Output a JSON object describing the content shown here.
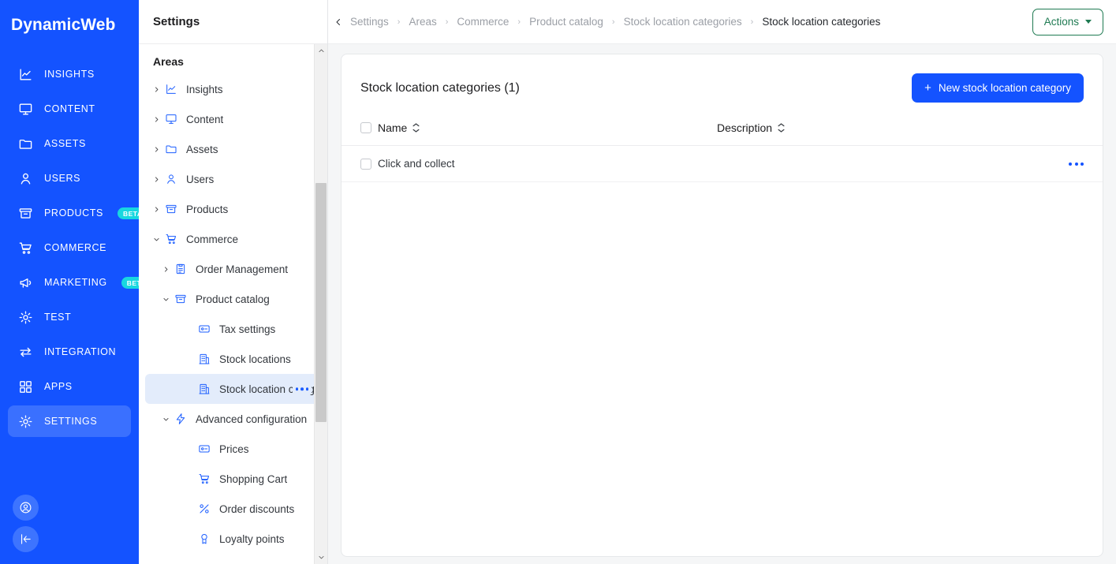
{
  "brand": {
    "name": "DynamicWeb"
  },
  "rail": {
    "items": [
      {
        "label": "INSIGHTS",
        "icon": "insights-icon",
        "badge": null,
        "active": false
      },
      {
        "label": "CONTENT",
        "icon": "monitor-icon",
        "badge": null,
        "active": false
      },
      {
        "label": "ASSETS",
        "icon": "folder-icon",
        "badge": null,
        "active": false
      },
      {
        "label": "USERS",
        "icon": "user-icon",
        "badge": null,
        "active": false
      },
      {
        "label": "PRODUCTS",
        "icon": "box-icon",
        "badge": "BETA",
        "active": false
      },
      {
        "label": "COMMERCE",
        "icon": "cart-icon",
        "badge": null,
        "active": false
      },
      {
        "label": "MARKETING",
        "icon": "megaphone-icon",
        "badge": "BETA",
        "active": false
      },
      {
        "label": "TEST",
        "icon": "gear-icon",
        "badge": null,
        "active": false
      },
      {
        "label": "INTEGRATION",
        "icon": "exchange-icon",
        "badge": null,
        "active": false
      },
      {
        "label": "APPS",
        "icon": "grid-icon",
        "badge": null,
        "active": false
      },
      {
        "label": "SETTINGS",
        "icon": "gear-icon",
        "badge": null,
        "active": true
      }
    ],
    "bottom": [
      {
        "icon": "account-circle-icon"
      },
      {
        "icon": "collapse-rail-icon"
      }
    ]
  },
  "panel": {
    "title": "Settings",
    "tree_title": "Areas",
    "nodes": [
      {
        "label": "Insights",
        "level": 1,
        "icon": "insights-icon",
        "chevron": "right",
        "selected": false
      },
      {
        "label": "Content",
        "level": 1,
        "icon": "monitor-icon",
        "chevron": "right",
        "selected": false
      },
      {
        "label": "Assets",
        "level": 1,
        "icon": "folder-icon",
        "chevron": "right",
        "selected": false
      },
      {
        "label": "Users",
        "level": 1,
        "icon": "user-icon",
        "chevron": "right",
        "selected": false
      },
      {
        "label": "Products",
        "level": 1,
        "icon": "box-icon",
        "chevron": "right",
        "selected": false
      },
      {
        "label": "Commerce",
        "level": 1,
        "icon": "cart-icon",
        "chevron": "down",
        "selected": false
      },
      {
        "label": "Order Management",
        "level": 2,
        "icon": "clipboard-icon",
        "chevron": "right",
        "selected": false
      },
      {
        "label": "Product catalog",
        "level": 2,
        "icon": "box-icon",
        "chevron": "down",
        "selected": false
      },
      {
        "label": "Tax settings",
        "level": 3,
        "icon": "card-icon",
        "chevron": "none",
        "selected": false
      },
      {
        "label": "Stock locations",
        "level": 3,
        "icon": "building-icon",
        "chevron": "none",
        "selected": false
      },
      {
        "label": "Stock location categories",
        "level": 3,
        "icon": "building-icon",
        "chevron": "none",
        "selected": true
      },
      {
        "label": "Advanced configuration",
        "level": 2,
        "icon": "bolt-icon",
        "chevron": "down",
        "selected": false
      },
      {
        "label": "Prices",
        "level": 3,
        "icon": "card-icon",
        "chevron": "none",
        "selected": false
      },
      {
        "label": "Shopping Cart",
        "level": 3,
        "icon": "cart-icon",
        "chevron": "none",
        "selected": false
      },
      {
        "label": "Order discounts",
        "level": 3,
        "icon": "percent-icon",
        "chevron": "none",
        "selected": false
      },
      {
        "label": "Loyalty points",
        "level": 3,
        "icon": "badge-icon",
        "chevron": "none",
        "selected": false
      }
    ],
    "overflow_ghost_text": "ri"
  },
  "topbar": {
    "breadcrumbs": [
      "Settings",
      "Areas",
      "Commerce",
      "Product catalog",
      "Stock location categories",
      "Stock location categories"
    ],
    "separator": "›",
    "actions_label": "Actions"
  },
  "card": {
    "title": "Stock location categories (1)",
    "new_button_label": "New stock location category",
    "new_button_plus": "+",
    "columns": [
      {
        "label": "Name",
        "sortable": true
      },
      {
        "label": "Description",
        "sortable": true
      }
    ],
    "rows": [
      {
        "name": "Click and collect",
        "description": ""
      }
    ]
  },
  "colors": {
    "brand_blue": "#1453ff",
    "rail_active": "#3a70ff",
    "beta_badge": "#18d7e0",
    "actions_green": "#1f7a52",
    "tree_selected": "#e3ecfb",
    "icon_blue": "#1a5cff"
  }
}
